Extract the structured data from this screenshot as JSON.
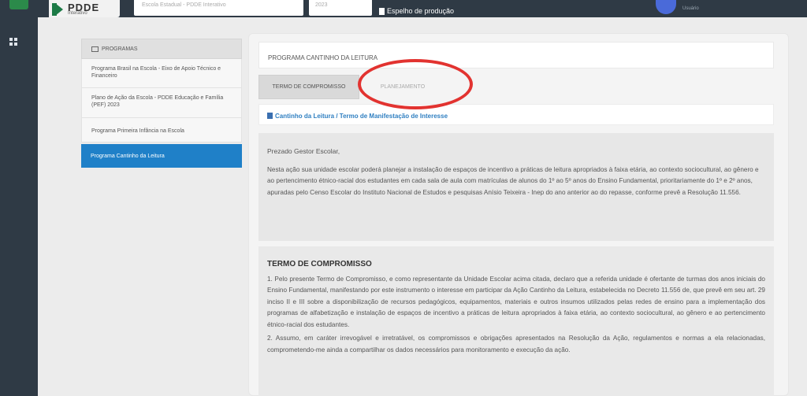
{
  "topbar": {
    "brand_text": "PDDE",
    "brand_sub": "Interativo",
    "select1_value": "Escola Estadual - PDDE Interativo",
    "select2_value": "2023",
    "espelho_label": "Espelho de produção",
    "user_name": "Usuário"
  },
  "sidebar": {
    "header": "PROGRAMAS",
    "items": [
      {
        "label": "Programa Brasil na Escola - Eixo de Apoio Técnico e Financeiro"
      },
      {
        "label": "Plano de Ação da Escola - PDDE Educação e Família (PEF) 2023"
      },
      {
        "label": "Programa Primeira Infância na Escola"
      },
      {
        "label": "Programa Cantinho da Leitura"
      }
    ]
  },
  "main": {
    "title": "PROGRAMA CANTINHO DA LEITURA",
    "tabs": [
      {
        "label": "TERMO DE COMPROMISSO"
      },
      {
        "label": "PLANEJAMENTO"
      }
    ],
    "breadcrumb": "Cantinho da Leitura / Termo de Manifestação de Interesse",
    "intro": {
      "greeting": "Prezado Gestor Escolar,",
      "text": "Nesta ação sua unidade escolar poderá planejar a instalação de espaços de incentivo a práticas de leitura apropriados à faixa etária, ao contexto sociocultural, ao gênero e ao pertencimento étnico-racial dos estudantes em cada sala de aula com matrículas de alunos do 1º ao 5º anos do Ensino Fundamental, prioritariamente do 1º e 2º anos, apuradas pelo Censo Escolar do Instituto Nacional de Estudos e pesquisas Anísio Teixeira - Inep do ano anterior ao do repasse, conforme prevê a Resolução 11.556."
    },
    "termo": {
      "heading": "TERMO DE COMPROMISSO",
      "p1": "1. Pelo presente Termo de Compromisso, e como representante da Unidade Escolar acima citada, declaro que a referida unidade é ofertante de turmas dos anos iniciais do Ensino Fundamental, manifestando por este instrumento o interesse em participar da Ação Cantinho da Leitura, estabelecida no Decreto 11.556 de, que prevê em seu art. 29 inciso II e III sobre a disponibilização de recursos pedagógicos, equipamentos, materiais e outros insumos utilizados pelas redes de ensino para a implementação dos programas de alfabetização e instalação de espaços de incentivo a práticas de leitura apropriados à faixa etária, ao contexto sociocultural, ao gênero e ao pertencimento étnico-racial dos estudantes.",
      "p2": "2. Assumo, em caráter irrevogável e irretratável, os compromissos e obrigações apresentados na Resolução da Ação, regulamentos e normas a ela relacionadas, comprometendo-me ainda a compartilhar os dados necessários para monitoramento e execução da ação."
    }
  },
  "colors": {
    "topbar": "#2f3a45",
    "active_item": "#1f80c8",
    "annotation_circle": "#e23330",
    "link": "#2f7fc1"
  }
}
